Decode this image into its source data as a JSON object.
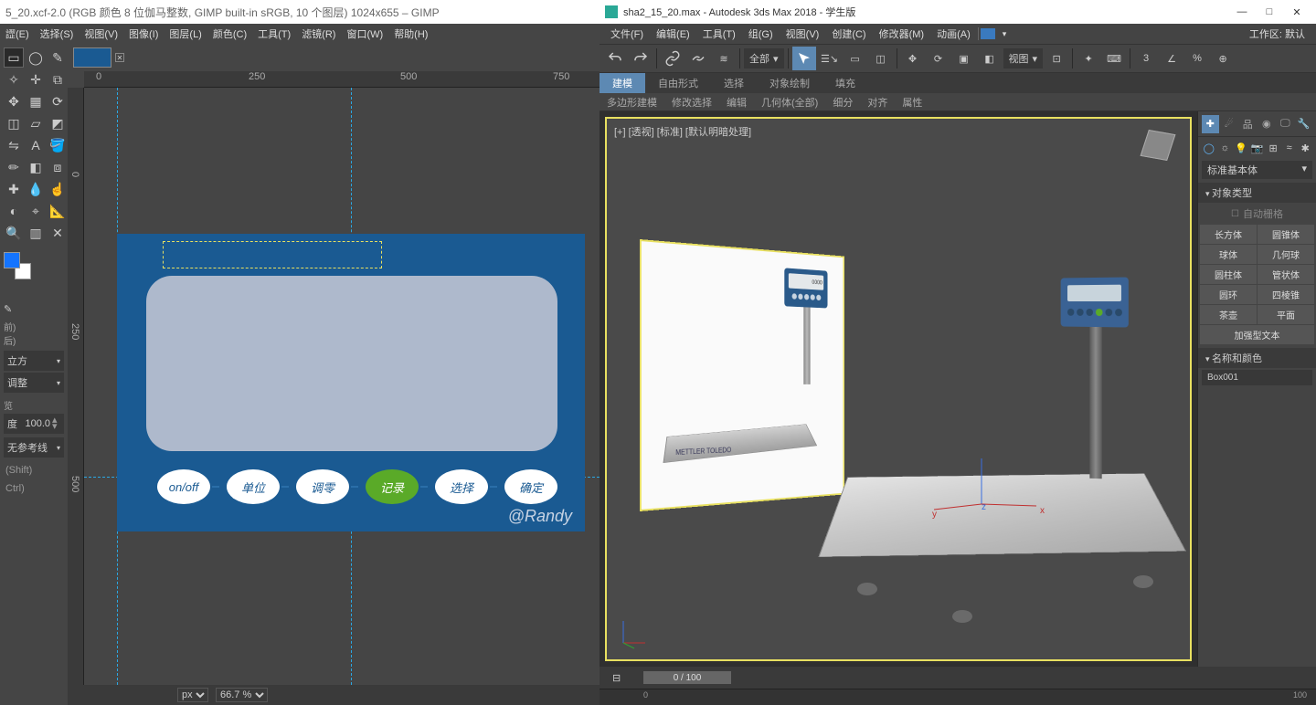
{
  "gimp": {
    "title": "5_20.xcf-2.0 (RGB 颜色 8 位伽马整数, GIMP built-in sRGB, 10 个图层) 1024x655 – GIMP",
    "menu": [
      "䜀(E)",
      "选择(S)",
      "视图(V)",
      "图像(I)",
      "图层(L)",
      "颜色(C)",
      "工具(T)",
      "滤镜(R)",
      "窗口(W)",
      "帮助(H)"
    ],
    "ruler_h": [
      {
        "p": 13,
        "v": "0"
      },
      {
        "p": 180,
        "v": "250"
      },
      {
        "p": 346,
        "v": "500"
      },
      {
        "p": 513,
        "v": "750"
      }
    ],
    "ruler_v": [
      {
        "p": 92,
        "v": "0"
      },
      {
        "p": 258,
        "v": "250"
      },
      {
        "p": 425,
        "v": "500"
      }
    ],
    "opts": {
      "before_label": "前)",
      "after_label": "后)",
      "cube": "立方",
      "adjust": "调整",
      "preview": "览",
      "degree_label": "度",
      "degree_value": "100.0",
      "noref": "无参考线",
      "shortcut_shift": "(Shift)",
      "shortcut_ctrl": "Ctrl)"
    },
    "artwork": {
      "buttons": [
        "on/off",
        "单位",
        "调零",
        "记录",
        "选择",
        "确定"
      ],
      "credit": "@Randy"
    },
    "status": {
      "unit": "px",
      "zoom": "66.7 %"
    }
  },
  "max": {
    "title": "sha2_15_20.max - Autodesk 3ds Max 2018  - 学生版",
    "menu": [
      "文件(F)",
      "编辑(E)",
      "工具(T)",
      "组(G)",
      "视图(V)",
      "创建(C)",
      "修改器(M)",
      "动画(A)"
    ],
    "workspace_label": "工作区: 默认",
    "toolbar": {
      "sel_filter": "全部",
      "view_dd": "视图"
    },
    "ribbon": [
      "建模",
      "自由形式",
      "选择",
      "对象绘制",
      "填充"
    ],
    "ribbon2": [
      "多边形建模",
      "修改选择",
      "编辑",
      "几何体(全部)",
      "细分",
      "对齐",
      "属性"
    ],
    "viewport": {
      "label": "[+]  [透视]  [标准]  [默认明暗处理]",
      "ref_display_value": "0000",
      "ref_brand": "METTLER  TOLEDO",
      "gizmo": {
        "x": "x",
        "y": "y",
        "z": "z"
      }
    },
    "time": {
      "slider": "0  /  100",
      "end": "100"
    },
    "cmd": {
      "category_dd": "标准基本体",
      "roll_objtype": "对象类型",
      "autogrid": "自动栅格",
      "primitives": [
        "长方体",
        "圆锥体",
        "球体",
        "几何球",
        "圆柱体",
        "管状体",
        "圆环",
        "四棱锥",
        "茶壶",
        "平面",
        "加强型文本"
      ],
      "roll_namecolor": "名称和颜色",
      "obj_name": "Box001"
    }
  }
}
